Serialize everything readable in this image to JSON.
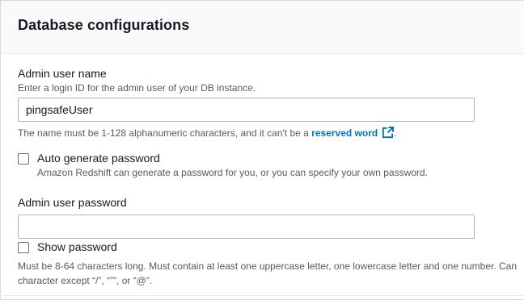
{
  "panel": {
    "title": "Database configurations"
  },
  "admin_user": {
    "label": "Admin user name",
    "description": "Enter a login ID for the admin user of your DB instance.",
    "value": "pingsafeUser",
    "constraint_prefix": "The name must be 1-128 alphanumeric characters, and it can't be a ",
    "constraint_link": "reserved word",
    "constraint_suffix": "."
  },
  "auto_password": {
    "label": "Auto generate password",
    "description": "Amazon Redshift can generate a password for you, or you can specify your own password.",
    "checked": false
  },
  "admin_password": {
    "label": "Admin user password",
    "value": "",
    "show_label": "Show password",
    "show_checked": false,
    "constraint_line1": "Must be 8-64 characters long. Must contain at least one uppercase letter, one lowercase letter and one number. Can",
    "constraint_line2": "character except “/”, “””, or “@”."
  },
  "colors": {
    "link": "#0073bb",
    "text": "#16191f",
    "muted": "#545b64",
    "border": "#aab7b8"
  },
  "icons": {
    "external_link": "external-link-icon"
  }
}
